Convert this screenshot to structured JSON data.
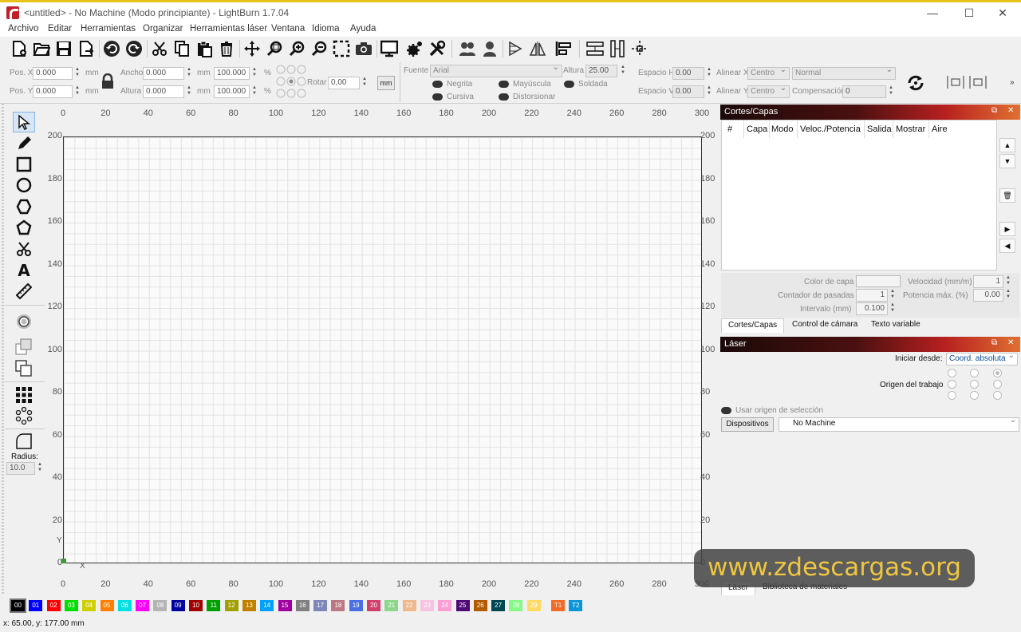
{
  "window": {
    "title": "<untitled> - No Machine (Modo principiante) - LightBurn 1.7.04",
    "minimize": "—",
    "maximize": "☐",
    "close": "✕"
  },
  "menu": [
    "Archivo",
    "Editar",
    "Herramientas",
    "Organizar",
    "Herramientas láser",
    "Ventana",
    "Idioma",
    "Ayuda"
  ],
  "toolbar_icons": [
    "new-file",
    "open-folder",
    "save",
    "export",
    "undo",
    "redo",
    "cut",
    "copy",
    "paste",
    "delete",
    "move",
    "zoom-frame",
    "zoom-in",
    "zoom-out",
    "select-area",
    "camera",
    "monitor",
    "settings",
    "wrench",
    "group",
    "ungroup",
    "mirror-h",
    "mirror-v",
    "align",
    "distribute-h",
    "distribute-v",
    "center"
  ],
  "props": {
    "posx_label": "Pos. X",
    "posx": "0.000",
    "posy_label": "Pos. Y",
    "posy": "0.000",
    "unit": "mm",
    "ancho_label": "Ancho",
    "ancho": "0.000",
    "altura_label": "Altura",
    "altura": "0.000",
    "pct_w": "100.000",
    "pct_h": "100.000",
    "pct": "%",
    "rotar_label": "Rotar",
    "rotar": "0,00",
    "mm_button": "mm",
    "fuente_label": "Fuente",
    "fuente": "Arial",
    "altura_txt_label": "Altura",
    "altura_txt": "25.00",
    "negrita": "Negrita",
    "cursiva": "Cursiva",
    "mayuscula": "Mayúscula",
    "soldada": "Soldada",
    "distorsionar": "Distorsionar",
    "espacio_h_label": "Espacio H",
    "espacio_h": "0.00",
    "espacio_v_label": "Espacio V",
    "espacio_v": "0.00",
    "alinear_x_label": "Alinear X",
    "alinear_x": "Centro",
    "alinear_y_label": "Alinear Y",
    "alinear_y": "Centro",
    "normal": "Normal",
    "compensacion_label": "Compensación",
    "compensacion": "0"
  },
  "left_tools": {
    "radius_label": "Radius:",
    "radius": "10.0",
    "text_tool": "A"
  },
  "canvas": {
    "x_ticks": [
      "0",
      "20",
      "40",
      "60",
      "80",
      "100",
      "120",
      "140",
      "160",
      "180",
      "200",
      "220",
      "240",
      "260",
      "280",
      "300"
    ],
    "y_ticks": [
      "200",
      "180",
      "160",
      "140",
      "120",
      "100",
      "80",
      "60",
      "40",
      "20",
      "0"
    ],
    "axis_x": "X",
    "axis_y": "Y"
  },
  "cuts_panel": {
    "title": "Cortes/Capas",
    "columns": [
      "#",
      "Capa",
      "Modo",
      "Veloc./Potencia",
      "Salida",
      "Mostrar",
      "Aire"
    ],
    "color_capa_label": "Color de capa",
    "velocidad_label": "Velocidad (mm/m)",
    "velocidad": "1",
    "contador_label": "Contador de pasadas",
    "contador": "1",
    "potencia_label": "Potencia máx. (%)",
    "potencia": "0.00",
    "intervalo_label": "Intervalo (mm)",
    "intervalo": "0.100",
    "tabs": [
      "Cortes/Capas",
      "Control de cámara",
      "Texto variable"
    ]
  },
  "laser_panel": {
    "title": "Láser",
    "iniciar_label": "Iniciar desde:",
    "iniciar": "Coord. absoluta",
    "origen_label": "Origen del trabajo",
    "usar_origen": "Usar origen de selección",
    "dispositivos": "Dispositivos",
    "machine": "No Machine",
    "tabs": [
      "Láser",
      "Biblioteca de materiales"
    ]
  },
  "palette": [
    {
      "label": "00",
      "color": "#000000"
    },
    {
      "label": "01",
      "color": "#0000ff"
    },
    {
      "label": "02",
      "color": "#ff0000"
    },
    {
      "label": "03",
      "color": "#00e000"
    },
    {
      "label": "04",
      "color": "#d0d000"
    },
    {
      "label": "05",
      "color": "#ff8000"
    },
    {
      "label": "06",
      "color": "#00e0e0"
    },
    {
      "label": "07",
      "color": "#ff00ff"
    },
    {
      "label": "08",
      "color": "#b4b4b4"
    },
    {
      "label": "09",
      "color": "#0000a0"
    },
    {
      "label": "10",
      "color": "#a00000"
    },
    {
      "label": "11",
      "color": "#00a000"
    },
    {
      "label": "12",
      "color": "#a0a000"
    },
    {
      "label": "13",
      "color": "#c08000"
    },
    {
      "label": "14",
      "color": "#00a0ff"
    },
    {
      "label": "15",
      "color": "#a000a0"
    },
    {
      "label": "16",
      "color": "#808080"
    },
    {
      "label": "17",
      "color": "#7d87b9"
    },
    {
      "label": "18",
      "color": "#bb7784"
    },
    {
      "label": "19",
      "color": "#4a6fe3"
    },
    {
      "label": "20",
      "color": "#d33f6a"
    },
    {
      "label": "21",
      "color": "#8cd78c"
    },
    {
      "label": "22",
      "color": "#f0b98d"
    },
    {
      "label": "23",
      "color": "#f6c4e1"
    },
    {
      "label": "24",
      "color": "#fa9ed4"
    },
    {
      "label": "25",
      "color": "#500a78"
    },
    {
      "label": "26",
      "color": "#b45a00"
    },
    {
      "label": "27",
      "color": "#004754"
    },
    {
      "label": "28",
      "color": "#86fa88"
    },
    {
      "label": "29",
      "color": "#ffdb66"
    },
    {
      "label": "T1",
      "color": "#f36926"
    },
    {
      "label": "T2",
      "color": "#0c96d9"
    }
  ],
  "status": "x: 65.00, y: 177.00 mm",
  "watermark": "www.zdescargas.org"
}
